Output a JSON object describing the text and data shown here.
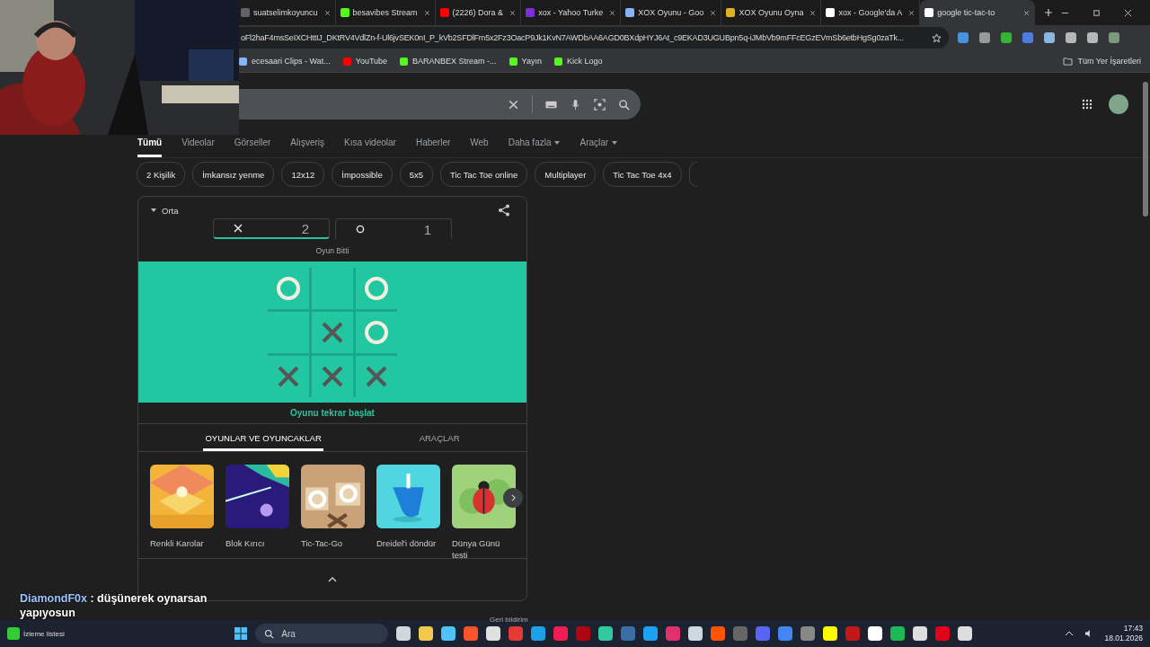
{
  "browser_tabs": [
    {
      "title": "suatselimkoyuncu",
      "selected": false,
      "color": "#5f6368"
    },
    {
      "title": "besavibes Stream",
      "selected": false,
      "color": "#53fc18"
    },
    {
      "title": "(2226) Dora &",
      "selected": false,
      "color": "#ff0000"
    },
    {
      "title": "xox - Yahoo Turke",
      "selected": false,
      "color": "#7b2fd6"
    },
    {
      "title": "XOX Oyunu - Goo",
      "selected": false,
      "color": "#8ab4f8"
    },
    {
      "title": "XOX Oyunu Oyna",
      "selected": false,
      "color": "#e0b020"
    },
    {
      "title": "xox - Google'da A",
      "selected": false,
      "color": "#ffffff"
    },
    {
      "title": "google tic-tac-to",
      "selected": true,
      "color": "#ffffff"
    }
  ],
  "address_bar": {
    "url": "oFl2haF4msSeIXCHttIJ_DKtRV4VdlZn-f-Ul6jvSEK0nI_P_kVb2SFDlFm5x2Fz3OacP9Jk1KvN7AWDbAA6AGD0BXdpHYJ6At_c9EKAD3UGUBpn5q-iJMbVb9mFFcEGzEVmSb6etbHgSg0zaTk..."
  },
  "bookmarks": [
    {
      "label": "ecesaari Clips - Wat...",
      "color": "#8ab4f8"
    },
    {
      "label": "YouTube",
      "color": "#ff0000"
    },
    {
      "label": "BARANBEX Stream -...",
      "color": "#53fc18"
    },
    {
      "label": "Yayın",
      "color": "#53fc18"
    },
    {
      "label": "Kick Logo",
      "color": "#53fc18"
    }
  ],
  "all_bookmarks": "Tüm Yer İşaretleri",
  "search_tabs": [
    {
      "label": "Tümü",
      "selected": true,
      "dropdown": false
    },
    {
      "label": "Videolar",
      "selected": false,
      "dropdown": false
    },
    {
      "label": "Görseller",
      "selected": false,
      "dropdown": false
    },
    {
      "label": "Alışveriş",
      "selected": false,
      "dropdown": false
    },
    {
      "label": "Kısa videolar",
      "selected": false,
      "dropdown": false
    },
    {
      "label": "Haberler",
      "selected": false,
      "dropdown": false
    },
    {
      "label": "Web",
      "selected": false,
      "dropdown": false
    },
    {
      "label": "Daha fazla",
      "selected": false,
      "dropdown": true
    },
    {
      "label": "Araçlar",
      "selected": false,
      "dropdown": true
    }
  ],
  "chips": [
    "2 Kişilik",
    "İmkansız yenme",
    "12x12",
    "İmpossible",
    "5x5",
    "Tic Tac Toe online",
    "Multiplayer",
    "Tic Tac Toe 4x4"
  ],
  "game": {
    "difficulty": "Orta",
    "scores": [
      {
        "kind": "x",
        "score": "2",
        "selected": true
      },
      {
        "kind": "o",
        "score": "1",
        "selected": false
      }
    ],
    "status": "Oyun Bitti",
    "board": [
      {
        "kind": "o"
      },
      {
        "kind": "empty"
      },
      {
        "kind": "o"
      },
      {
        "kind": "empty"
      },
      {
        "kind": "x"
      },
      {
        "kind": "o"
      },
      {
        "kind": "x"
      },
      {
        "kind": "x"
      },
      {
        "kind": "x"
      }
    ],
    "restart": "Oyunu tekrar başlat",
    "tabs": [
      {
        "label": "OYUNLAR VE OYUNCAKLAR",
        "selected": true
      },
      {
        "label": "ARAÇLAR",
        "selected": false
      }
    ],
    "games": [
      {
        "title": "Renkli Karolar",
        "kind": "tiles"
      },
      {
        "title": "Blok Kırıcı",
        "kind": "breaker"
      },
      {
        "title": "Tic-Tac-Go",
        "kind": "tictac"
      },
      {
        "title": "Dreidel'i döndür",
        "kind": "dreidel"
      },
      {
        "title": "Dünya Günü testi",
        "kind": "ladybug"
      }
    ]
  },
  "feedback": "Geri bildirim",
  "stream_chat": {
    "user": "DiamondF0x",
    "message": ": düşünerek oynarsan yapıyosun"
  },
  "widget": "İzleme listesi",
  "taskbar": {
    "search_placeholder": "Ara",
    "time": "17:43",
    "date": "18.01.2026"
  }
}
